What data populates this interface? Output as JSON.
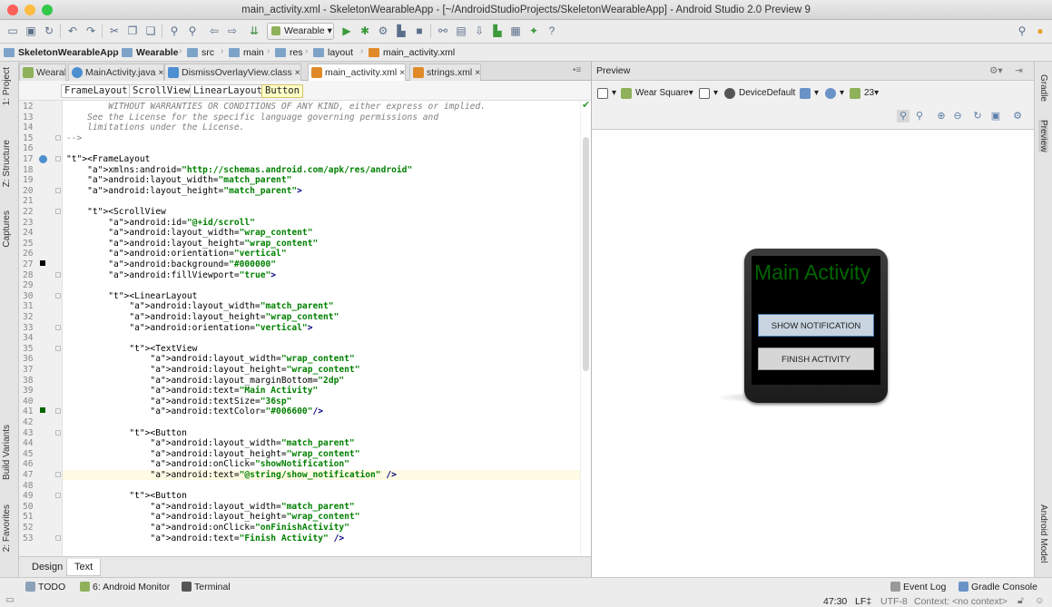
{
  "window": {
    "title": "main_activity.xml - SkeletonWearableApp - [~/AndroidStudioProjects/SkeletonWearableApp] - Android Studio 2.0 Preview 9",
    "traffic_colors": [
      "#fc605b",
      "#fdbc40",
      "#34c84a"
    ]
  },
  "toolbar": {
    "run_config": "Wearable",
    "help_label": "?"
  },
  "breadcrumb": [
    {
      "label": "SkeletonWearableApp"
    },
    {
      "label": "Wearable"
    },
    {
      "label": "src"
    },
    {
      "label": "main"
    },
    {
      "label": "res"
    },
    {
      "label": "layout"
    },
    {
      "label": "main_activity.xml"
    }
  ],
  "left_tool_windows": [
    "1: Project",
    "Z: Structure",
    "Captures",
    "Build Variants",
    "2: Favorites"
  ],
  "right_tool_windows": [
    "Gradle",
    "Preview",
    "Android Model"
  ],
  "editor_tabs": [
    {
      "label": "Wearable ×",
      "color": "#8fb15a"
    },
    {
      "label": "MainActivity.java ×",
      "color": "#4d8fd1"
    },
    {
      "label": "DismissOverlayView.class ×",
      "color": "#4d8fd1"
    },
    {
      "label": "main_activity.xml ×",
      "color": "#e08a2a"
    },
    {
      "label": "strings.xml ×",
      "color": "#e08a2a"
    }
  ],
  "element_path": [
    "FrameLayout",
    "ScrollView",
    "LinearLayout",
    "Button"
  ],
  "code": {
    "lines": [
      {
        "n": "12",
        "t": "        WITHOUT WARRANTIES OR CONDITIONS OF ANY KIND, either express or implied."
      },
      {
        "n": "13",
        "t": "    See the License for the specific language governing permissions and"
      },
      {
        "n": "14",
        "t": "    limitations under the License."
      },
      {
        "n": "15",
        "t": "-->"
      },
      {
        "n": "16",
        "t": ""
      },
      {
        "n": "17",
        "t": "<FrameLayout"
      },
      {
        "n": "18",
        "t": "    xmlns:android=\"http://schemas.android.com/apk/res/android\""
      },
      {
        "n": "19",
        "t": "    android:layout_width=\"match_parent\""
      },
      {
        "n": "20",
        "t": "    android:layout_height=\"match_parent\">"
      },
      {
        "n": "21",
        "t": ""
      },
      {
        "n": "22",
        "t": "    <ScrollView"
      },
      {
        "n": "23",
        "t": "        android:id=\"@+id/scroll\""
      },
      {
        "n": "24",
        "t": "        android:layout_width=\"wrap_content\""
      },
      {
        "n": "25",
        "t": "        android:layout_height=\"wrap_content\""
      },
      {
        "n": "26",
        "t": "        android:orientation=\"vertical\""
      },
      {
        "n": "27",
        "t": "        android:background=\"#000000\""
      },
      {
        "n": "28",
        "t": "        android:fillViewport=\"true\">"
      },
      {
        "n": "29",
        "t": ""
      },
      {
        "n": "30",
        "t": "        <LinearLayout"
      },
      {
        "n": "31",
        "t": "            android:layout_width=\"match_parent\""
      },
      {
        "n": "32",
        "t": "            android:layout_height=\"wrap_content\""
      },
      {
        "n": "33",
        "t": "            android:orientation=\"vertical\">"
      },
      {
        "n": "34",
        "t": ""
      },
      {
        "n": "35",
        "t": "            <TextView"
      },
      {
        "n": "36",
        "t": "                android:layout_width=\"wrap_content\""
      },
      {
        "n": "37",
        "t": "                android:layout_height=\"wrap_content\""
      },
      {
        "n": "38",
        "t": "                android:layout_marginBottom=\"2dp\""
      },
      {
        "n": "39",
        "t": "                android:text=\"Main Activity\""
      },
      {
        "n": "40",
        "t": "                android:textSize=\"36sp\""
      },
      {
        "n": "41",
        "t": "                android:textColor=\"#006600\"/>"
      },
      {
        "n": "42",
        "t": ""
      },
      {
        "n": "43",
        "t": "            <Button"
      },
      {
        "n": "44",
        "t": "                android:layout_width=\"match_parent\""
      },
      {
        "n": "45",
        "t": "                android:layout_height=\"wrap_content\""
      },
      {
        "n": "46",
        "t": "                android:onClick=\"showNotification\""
      },
      {
        "n": "47",
        "t": "                android:text=\"@string/show_notification\" />"
      },
      {
        "n": "48",
        "t": ""
      },
      {
        "n": "49",
        "t": "            <Button"
      },
      {
        "n": "50",
        "t": "                android:layout_width=\"match_parent\""
      },
      {
        "n": "51",
        "t": "                android:layout_height=\"wrap_content\""
      },
      {
        "n": "52",
        "t": "                android:onClick=\"onFinishActivity\""
      },
      {
        "n": "53",
        "t": "                android:text=\"Finish Activity\" />"
      }
    ]
  },
  "design_tabs": [
    "Design",
    "Text"
  ],
  "preview": {
    "header": "Preview",
    "device": "Wear Square",
    "theme": "DeviceDefault",
    "api": "23",
    "watch_title": "Main Activity",
    "watch_title_color": "#006600",
    "buttons": [
      "SHOW NOTIFICATION",
      "FINISH ACTIVITY"
    ]
  },
  "statusbar": {
    "todo": "TODO",
    "monitor": "6: Android Monitor",
    "terminal": "Terminal",
    "event_log": "Event Log",
    "gradle_console": "Gradle Console",
    "position": "47:30",
    "line_sep": "LF‡",
    "encoding": "UTF-8",
    "context": "Context: <no context>"
  }
}
